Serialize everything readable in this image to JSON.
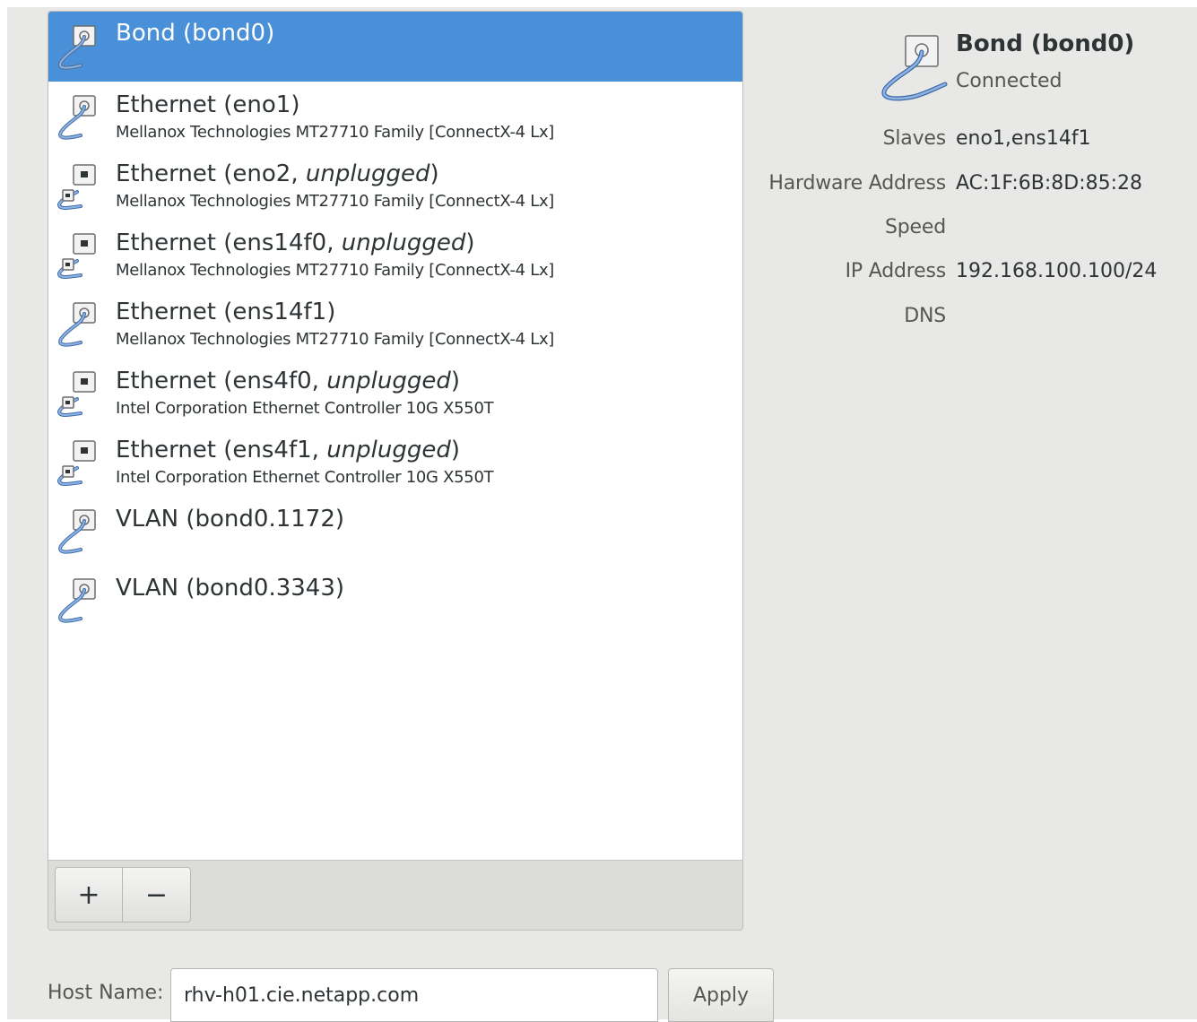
{
  "devices": [
    {
      "name": "Bond (bond0)",
      "name_prefix": "Bond (bond0)",
      "status_suffix": "",
      "description": "",
      "icon": "network-wired-icon",
      "selected": true
    },
    {
      "name_prefix": "Ethernet (eno1)",
      "status_suffix": "",
      "description": "Mellanox Technologies MT27710 Family [ConnectX-4 Lx]",
      "icon": "network-wired-icon"
    },
    {
      "name_prefix": "Ethernet (eno2, ",
      "status_suffix": "unplugged",
      "description": "Mellanox Technologies MT27710 Family [ConnectX-4 Lx]",
      "icon": "network-wired-disconnected-icon"
    },
    {
      "name_prefix": "Ethernet (ens14f0, ",
      "status_suffix": "unplugged",
      "description": "Mellanox Technologies MT27710 Family [ConnectX-4 Lx]",
      "icon": "network-wired-disconnected-icon"
    },
    {
      "name_prefix": "Ethernet (ens14f1)",
      "status_suffix": "",
      "description": "Mellanox Technologies MT27710 Family [ConnectX-4 Lx]",
      "icon": "network-wired-icon"
    },
    {
      "name_prefix": "Ethernet (ens4f0, ",
      "status_suffix": "unplugged",
      "description": "Intel Corporation Ethernet Controller 10G X550T",
      "icon": "network-wired-disconnected-icon"
    },
    {
      "name_prefix": "Ethernet (ens4f1, ",
      "status_suffix": "unplugged",
      "description": "Intel Corporation Ethernet Controller 10G X550T",
      "icon": "network-wired-disconnected-icon"
    },
    {
      "name_prefix": "VLAN (bond0.1172)",
      "status_suffix": "",
      "description": "",
      "icon": "network-wired-icon"
    },
    {
      "name_prefix": "VLAN (bond0.3343)",
      "status_suffix": "",
      "description": "",
      "icon": "network-wired-icon"
    }
  ],
  "toolbar": {
    "add_label": "+",
    "remove_label": "−"
  },
  "details": {
    "title": "Bond (bond0)",
    "status": "Connected",
    "rows": [
      {
        "label": "Slaves",
        "value": "eno1,ens14f1"
      },
      {
        "label": "Hardware Address",
        "value": "AC:1F:6B:8D:85:28"
      },
      {
        "label": "Speed",
        "value": ""
      },
      {
        "label": "IP Address",
        "value": "192.168.100.100/24"
      },
      {
        "label": "DNS",
        "value": ""
      }
    ]
  },
  "hostname": {
    "label": "Host Name:",
    "value": "rhv-h01.cie.netapp.com",
    "apply_label": "Apply"
  },
  "colors": {
    "selection": "#4a90d9",
    "cable": "#5b8fd0",
    "background": "#e8e8e7"
  }
}
